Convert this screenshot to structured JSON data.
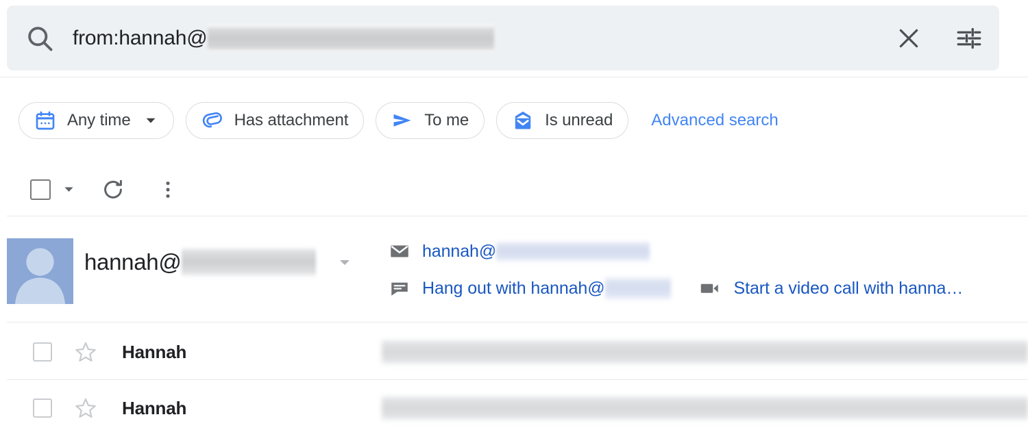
{
  "search": {
    "query_text": "from:hannah@",
    "query_redacted": true,
    "search_icon": "search-icon",
    "clear_icon": "close-icon",
    "options_icon": "tune-options-icon",
    "background_color": "#eef1f3"
  },
  "filters": {
    "chips": [
      {
        "label": "Any time",
        "icon": "calendar-icon",
        "icon_color": "#4285f4",
        "has_dropdown": true
      },
      {
        "label": "Has attachment",
        "icon": "paperclip-icon",
        "icon_color": "#4285f4",
        "has_dropdown": false
      },
      {
        "label": "To me",
        "icon": "send-icon",
        "icon_color": "#4285f4",
        "has_dropdown": false
      },
      {
        "label": "Is unread",
        "icon": "mail-unread-icon",
        "icon_color": "#4285f4",
        "has_dropdown": false
      }
    ],
    "advanced_search_label": "Advanced search",
    "link_color": "#4285f4"
  },
  "toolbar": {
    "select_all_icon": "checkbox-unchecked-icon",
    "select_all_caret": "chevron-down-icon",
    "refresh_icon": "refresh-icon",
    "more_icon": "more-vertical-icon"
  },
  "contact": {
    "avatar_icon": "default-person-avatar",
    "avatar_bg": "#8ba7d6",
    "name": "hannah@",
    "name_redacted": true,
    "caret_icon": "chevron-down-icon",
    "actions": [
      {
        "icon": "envelope-icon",
        "label": "hannah@",
        "redacted": true,
        "color": "#1a57c2"
      },
      {
        "icon": "chat-bubble-icon",
        "label": "Hang out with hannah@",
        "redacted": true,
        "color": "#1a57c2"
      },
      {
        "icon": "video-camera-icon",
        "label": "Start a video call with hanna…",
        "redacted": false,
        "color": "#1a57c2"
      }
    ]
  },
  "mail_list": {
    "rows": [
      {
        "sender": "Hannah",
        "checkbox_icon": "checkbox-unchecked-icon",
        "star_icon": "star-outline-icon",
        "subject_redacted": true
      },
      {
        "sender": "Hannah",
        "checkbox_icon": "checkbox-unchecked-icon",
        "star_icon": "star-outline-icon",
        "subject_redacted": true
      }
    ]
  }
}
